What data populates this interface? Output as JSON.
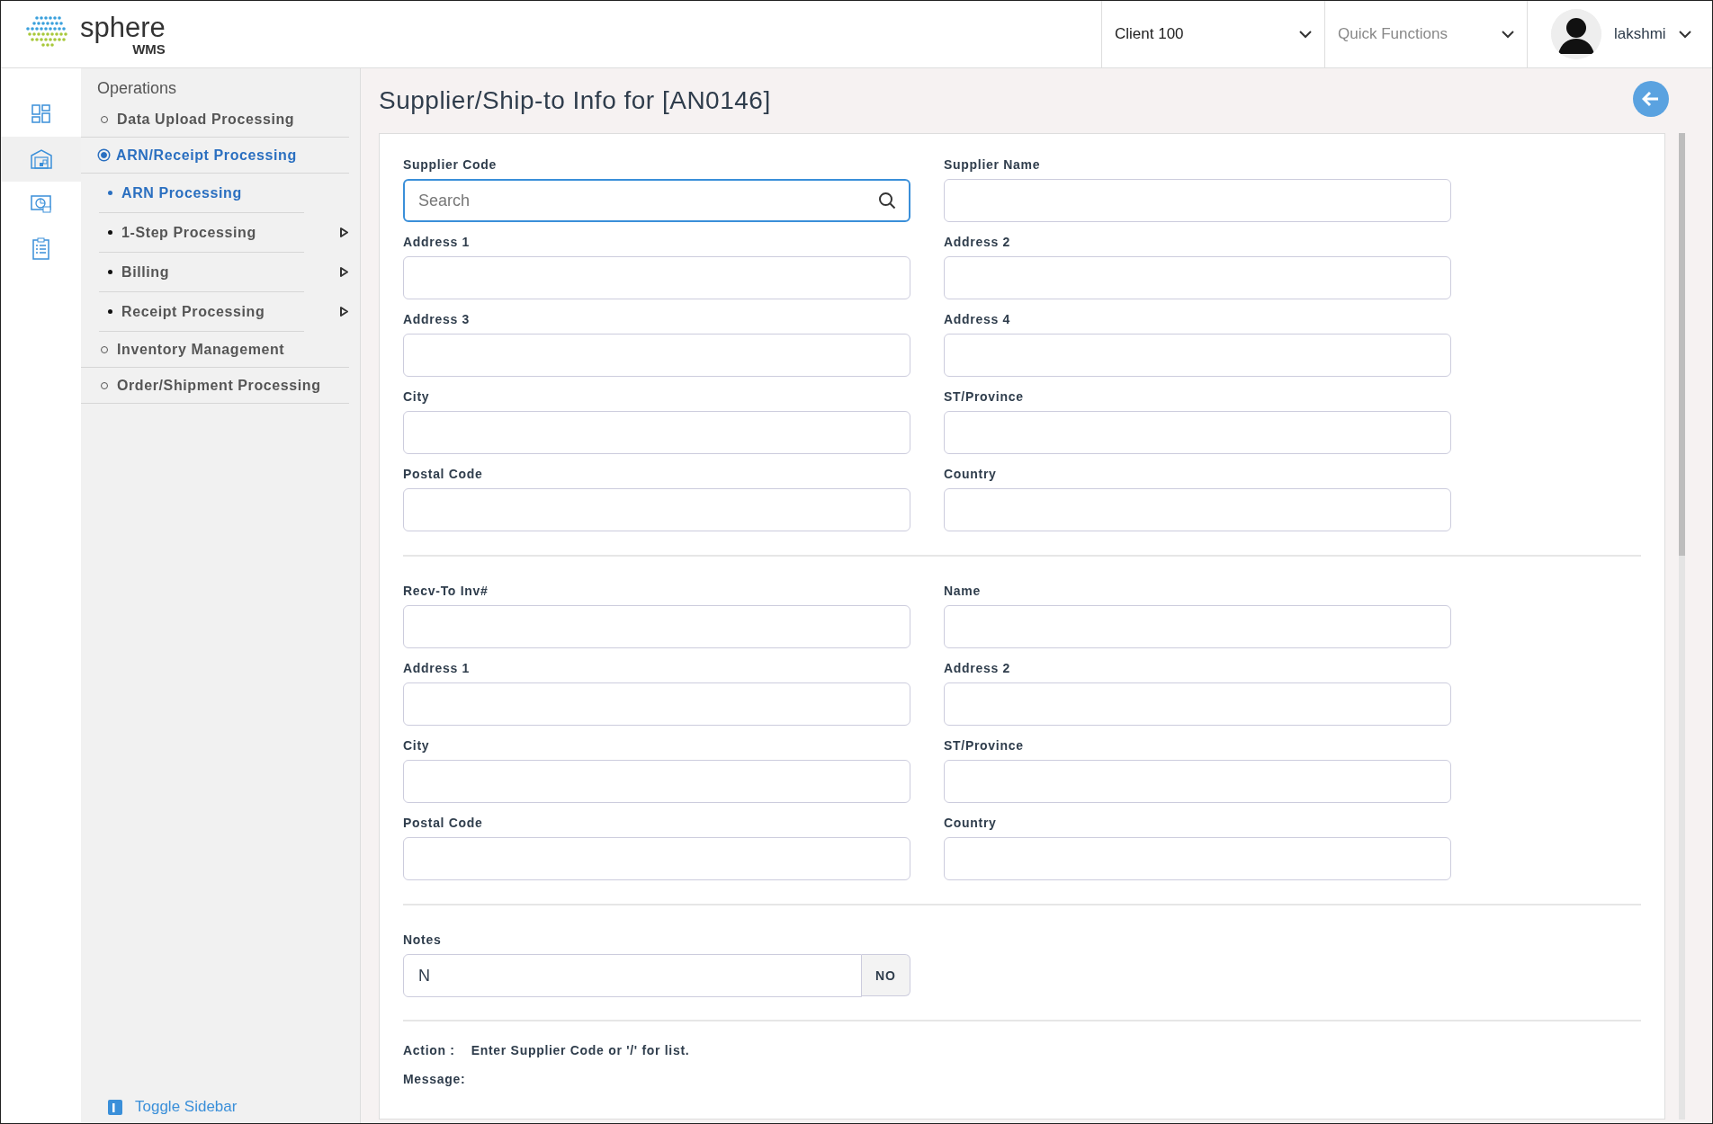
{
  "header": {
    "logo": {
      "name": "sphere",
      "sub": "WMS"
    },
    "client_select": {
      "value": "Client 100"
    },
    "quick_functions": {
      "placeholder": "Quick Functions"
    },
    "user": {
      "name": "lakshmi"
    }
  },
  "rail": [
    {
      "kind": "dashboard",
      "selected": false
    },
    {
      "kind": "warehouse",
      "selected": true
    },
    {
      "kind": "report",
      "selected": false
    },
    {
      "kind": "clipboard",
      "selected": false
    }
  ],
  "sidebar": {
    "title": "Operations",
    "items": [
      {
        "label": "Data Upload Processing",
        "selected": false
      },
      {
        "label": "ARN/Receipt Processing",
        "selected": true,
        "children": [
          {
            "label": "ARN Processing",
            "selected": true,
            "submenu": false
          },
          {
            "label": "1-Step Processing",
            "selected": false,
            "submenu": true
          },
          {
            "label": "Billing",
            "selected": false,
            "submenu": true
          },
          {
            "label": "Receipt Processing",
            "selected": false,
            "submenu": true
          }
        ]
      },
      {
        "label": "Inventory Management",
        "selected": false
      },
      {
        "label": "Order/Shipment Processing",
        "selected": false
      }
    ],
    "toggle": "Toggle Sidebar"
  },
  "page": {
    "title": "Supplier/Ship-to Info for [AN0146]",
    "sections": [
      {
        "fields": [
          {
            "label": "Supplier Code",
            "kind": "search",
            "placeholder": "Search",
            "focused": true
          },
          {
            "label": "Supplier Name",
            "kind": "text",
            "focused": false
          },
          {
            "label": "Address 1",
            "kind": "text",
            "focused": false
          },
          {
            "label": "Address 2",
            "kind": "text",
            "focused": false
          },
          {
            "label": "Address 3",
            "kind": "text",
            "focused": false
          },
          {
            "label": "Address 4",
            "kind": "text",
            "focused": false
          },
          {
            "label": "City",
            "kind": "text",
            "focused": false
          },
          {
            "label": "ST/Province",
            "kind": "text",
            "focused": false
          },
          {
            "label": "Postal Code",
            "kind": "text",
            "focused": false
          },
          {
            "label": "Country",
            "kind": "text",
            "focused": false
          }
        ]
      },
      {
        "fields": [
          {
            "label": "Recv-To Inv#",
            "kind": "text",
            "focused": false
          },
          {
            "label": "Name",
            "kind": "text",
            "focused": false
          },
          {
            "label": "Address 1",
            "kind": "text",
            "focused": false
          },
          {
            "label": "Address 2",
            "kind": "text",
            "focused": false
          },
          {
            "label": "City",
            "kind": "text",
            "focused": false
          },
          {
            "label": "ST/Province",
            "kind": "text",
            "focused": false
          },
          {
            "label": "Postal Code",
            "kind": "text",
            "focused": false
          },
          {
            "label": "Country",
            "kind": "text",
            "focused": false
          }
        ]
      }
    ],
    "notes": {
      "label": "Notes",
      "value": "N",
      "addon": "NO"
    },
    "action": {
      "label": "Action :",
      "text": "Enter Supplier Code or '/' for list."
    },
    "message": {
      "label": "Message:"
    }
  }
}
